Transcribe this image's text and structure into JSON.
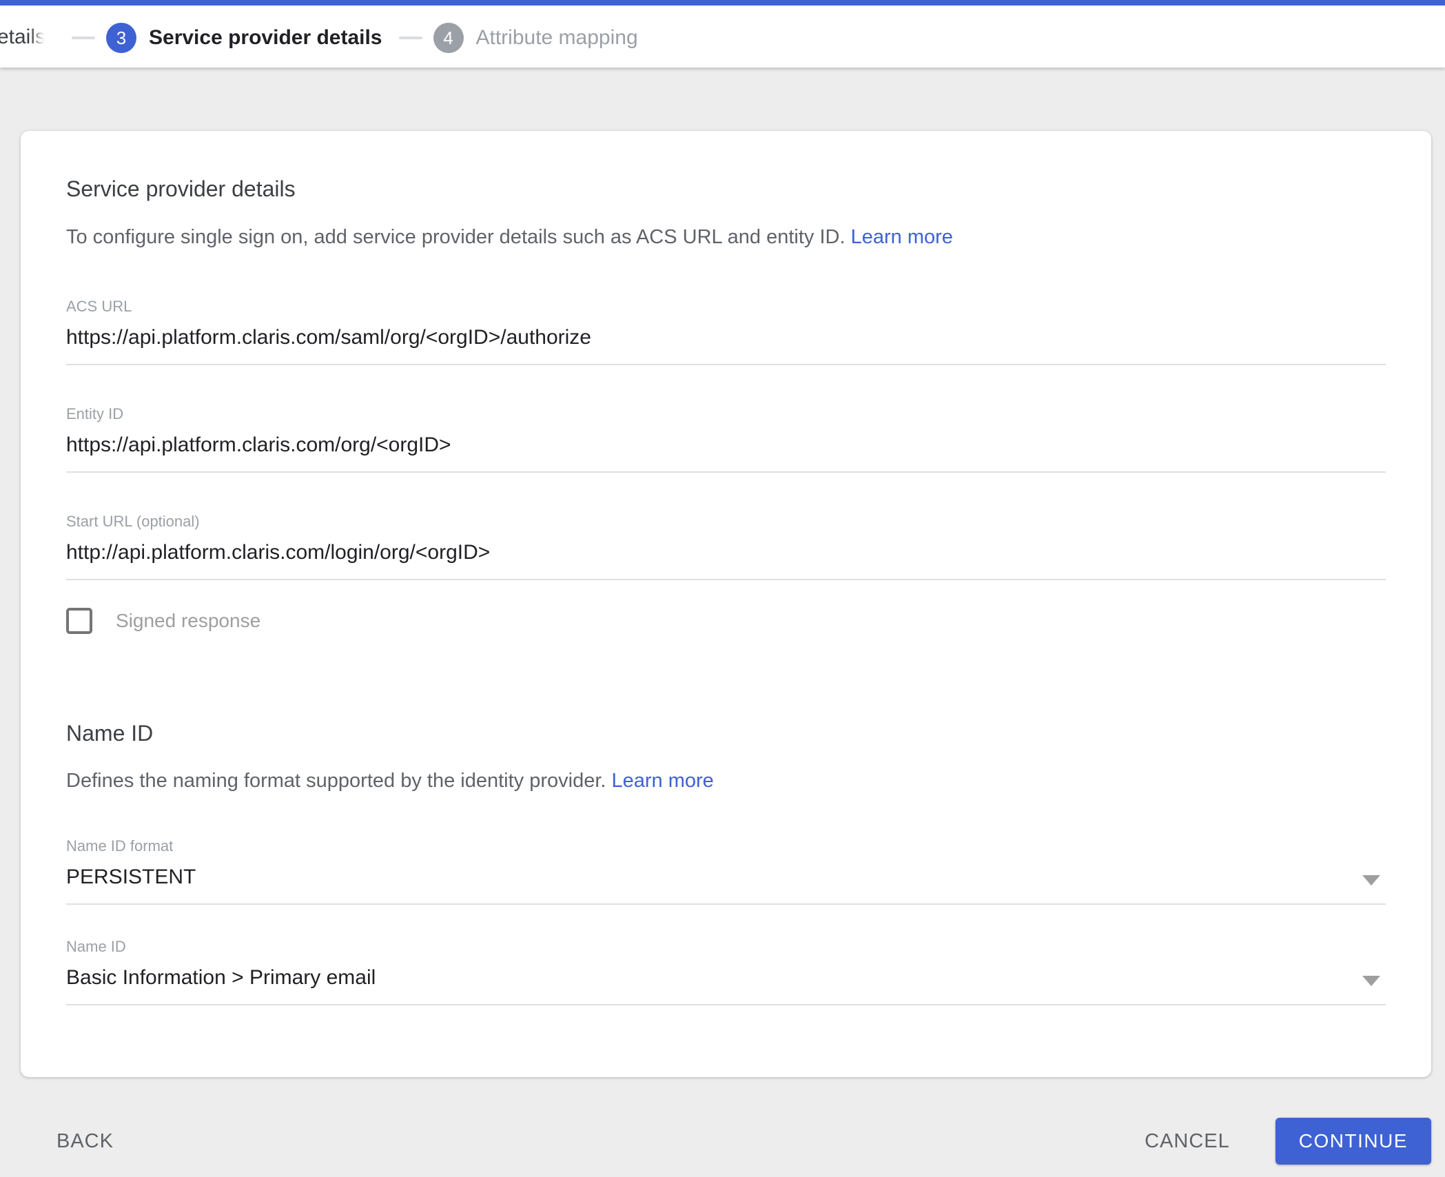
{
  "stepper": {
    "previous_step_label": "provider details",
    "steps": [
      {
        "number": "3",
        "label": "Service provider details",
        "state": "active"
      },
      {
        "number": "4",
        "label": "Attribute mapping",
        "state": "upcoming"
      }
    ]
  },
  "card": {
    "title": "Service provider details",
    "description": "To configure single sign on, add service provider details such as ACS URL and entity ID.",
    "learn_more_label": "Learn more",
    "fields": {
      "acs_url": {
        "label": "ACS URL",
        "value": "https://api.platform.claris.com/saml/org/<orgID>/authorize"
      },
      "entity_id": {
        "label": "Entity ID",
        "value": "https://api.platform.claris.com/org/<orgID>"
      },
      "start_url": {
        "label": "Start URL (optional)",
        "value": "http://api.platform.claris.com/login/org/<orgID>"
      }
    },
    "signed_response": {
      "label": "Signed response",
      "checked": false
    },
    "name_id_section": {
      "title": "Name ID",
      "description": "Defines the naming format supported by the identity provider.",
      "learn_more_label": "Learn more",
      "name_id_format": {
        "label": "Name ID format",
        "value": "PERSISTENT"
      },
      "name_id": {
        "label": "Name ID",
        "value": "Basic Information > Primary email"
      }
    }
  },
  "footer": {
    "back_label": "BACK",
    "cancel_label": "CANCEL",
    "continue_label": "CONTINUE"
  },
  "colors": {
    "accent_blue": "#3E61D4",
    "link_blue": "#3E61D4",
    "step_inactive_gray": "#9AA0A6",
    "background": "#EDEDED"
  }
}
